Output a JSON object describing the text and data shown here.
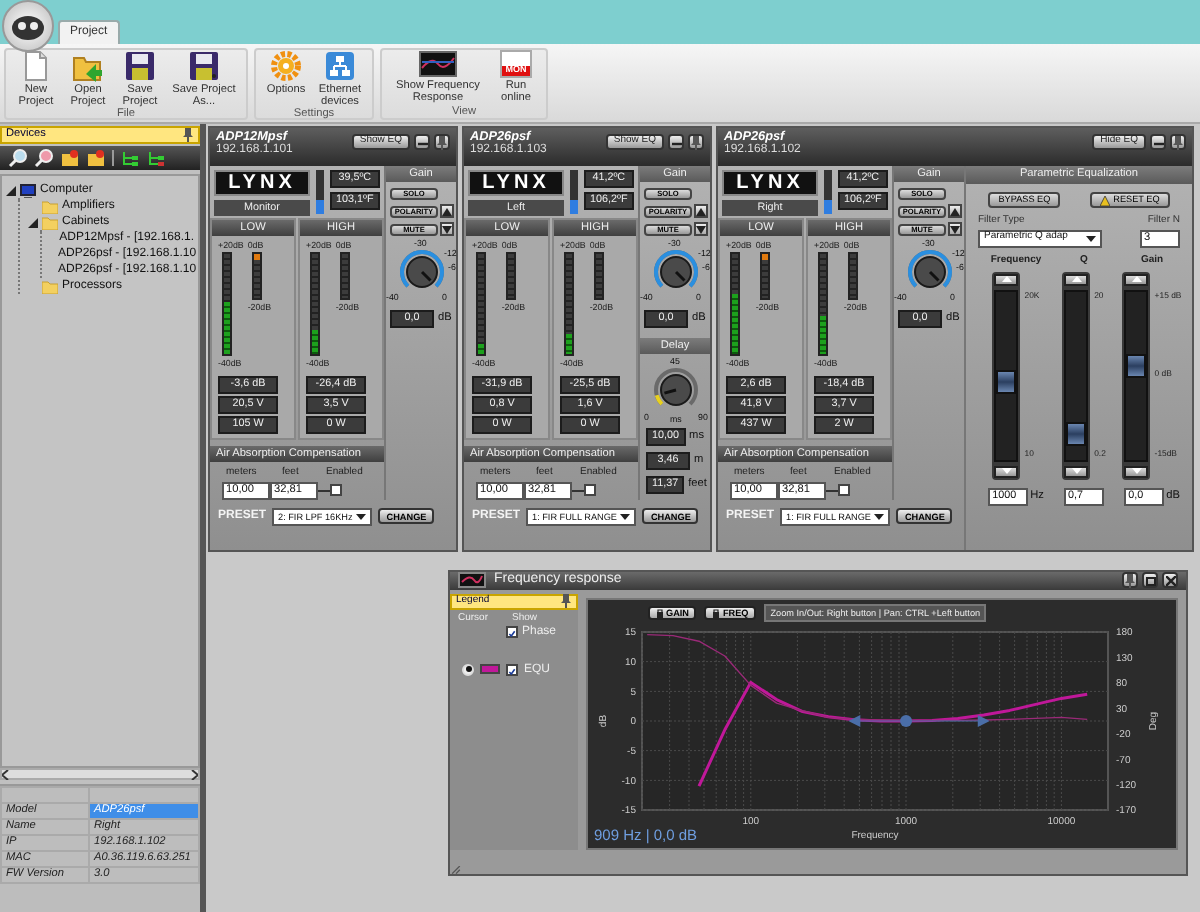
{
  "app_tabs": [
    {
      "label": "Project",
      "selected": true
    }
  ],
  "ribbon": {
    "groups": [
      {
        "label": "File",
        "buttons": [
          {
            "label": "New Project",
            "kind": "new"
          },
          {
            "label": "Open Project",
            "kind": "open"
          },
          {
            "label": "Save Project",
            "kind": "save"
          },
          {
            "label": "Save Project As...",
            "kind": "save-as"
          }
        ]
      },
      {
        "label": "Settings",
        "buttons": [
          {
            "label": "Options",
            "kind": "options"
          },
          {
            "label": "Ethernet devices",
            "kind": "ethernet"
          }
        ]
      },
      {
        "label": "View",
        "buttons": [
          {
            "label": "Show Frequency Response",
            "kind": "frequency"
          },
          {
            "label": "Run online",
            "kind": "online",
            "icon_text": "MON"
          }
        ]
      }
    ]
  },
  "devices_panel": {
    "title": "Devices",
    "tree": [
      {
        "label": "Computer",
        "kind": "computer",
        "expanded": true,
        "children": [
          {
            "label": "Amplifiers",
            "kind": "folder"
          },
          {
            "label": "Cabinets",
            "kind": "folder",
            "expanded": true,
            "children": [
              {
                "label": "ADP12Mpsf - [192.168.1.",
                "kind": "device"
              },
              {
                "label": "ADP26psf - [192.168.1.10",
                "kind": "device"
              },
              {
                "label": "ADP26psf - [192.168.1.10",
                "kind": "device"
              }
            ]
          },
          {
            "label": "Processors",
            "kind": "folder"
          }
        ]
      }
    ],
    "properties": [
      {
        "label": "Model",
        "value": "ADP26psf",
        "selected": true
      },
      {
        "label": "Name",
        "value": "Right",
        "selected": false
      },
      {
        "label": "IP",
        "value": "192.168.1.102",
        "selected": false
      },
      {
        "label": "MAC",
        "value": "A0.36.119.6.63.251",
        "selected": false
      },
      {
        "label": "FW Version",
        "value": "3.0",
        "selected": false
      }
    ]
  },
  "devices": [
    {
      "model": "ADP12Mpsf",
      "ip": "192.168.1.101",
      "eq_button": "Show EQ",
      "logo": "LYNX",
      "name": "Monitor",
      "temperature": {
        "level": 0.3,
        "celsius": "39,5ºC",
        "fahrenheit": "103,1ºF"
      },
      "bands": [
        {
          "title": "LOW",
          "scale_top": [
            "+20dB",
            "0dB"
          ],
          "limiter_label": "-20dB",
          "scale_bottom": "-40dB",
          "level": 0.52,
          "limiter": {
            "level": 0.12
          },
          "readings": [
            "-3,6 dB",
            "20,5 V",
            "105 W"
          ]
        },
        {
          "title": "HIGH",
          "scale_top": [
            "+20dB",
            "0dB"
          ],
          "limiter_label": "-20dB",
          "scale_bottom": "-40dB",
          "level": 0.25,
          "readings": [
            "-26,4 dB",
            "3,5 V",
            "0 W"
          ]
        }
      ],
      "gain": {
        "title": "Gain",
        "buttons": [
          "SOLO",
          "POLARITY",
          "MUTE"
        ],
        "scale": [
          "-30",
          "-12",
          "-6",
          "0",
          "-40"
        ],
        "level": 1,
        "value": "0,0",
        "unit": "dB"
      },
      "air": {
        "title": "Air Absorption Compensation",
        "labels": [
          "meters",
          "feet",
          "Enabled"
        ],
        "meters": "10,00",
        "feet": "32,81",
        "enabled": false
      },
      "preset": {
        "label": "PRESET",
        "value": "2: FIR LPF 16KHz",
        "button": "CHANGE"
      }
    },
    {
      "model": "ADP26psf",
      "ip": "192.168.1.103",
      "eq_button": "Show EQ",
      "logo": "LYNX",
      "name": "Left",
      "temperature": {
        "level": 0.3,
        "celsius": "41,2ºC",
        "fahrenheit": "106,2ºF"
      },
      "bands": [
        {
          "title": "LOW",
          "scale_top": [
            "+20dB",
            "0dB"
          ],
          "limiter_label": "-20dB",
          "scale_bottom": "-40dB",
          "level": 0.1,
          "readings": [
            "-31,9 dB",
            "0,8 V",
            "0 W"
          ]
        },
        {
          "title": "HIGH",
          "scale_top": [
            "+20dB",
            "0dB"
          ],
          "limiter_label": "-20dB",
          "scale_bottom": "-40dB",
          "level": 0.2,
          "readings": [
            "-25,5 dB",
            "1,6 V",
            "0 W"
          ]
        }
      ],
      "gain": {
        "title": "Gain",
        "buttons": [
          "SOLO",
          "POLARITY",
          "MUTE"
        ],
        "scale": [
          "-30",
          "-12",
          "-6",
          "0",
          "-40"
        ],
        "level": 1,
        "value": "0,0",
        "unit": "dB"
      },
      "delay": {
        "title": "Delay",
        "scale": [
          "45",
          "0",
          "ms",
          "90"
        ],
        "level": 0.11,
        "readings": [
          {
            "value": "10,00",
            "unit": "ms"
          },
          {
            "value": "3,46",
            "unit": "m"
          },
          {
            "value": "11,37",
            "unit": "feet"
          }
        ]
      },
      "air": {
        "title": "Air Absorption Compensation",
        "labels": [
          "meters",
          "feet",
          "Enabled"
        ],
        "meters": "10,00",
        "feet": "32,81",
        "enabled": false
      },
      "preset": {
        "label": "PRESET",
        "value": "1: FIR FULL RANGE",
        "button": "CHANGE"
      }
    },
    {
      "model": "ADP26psf",
      "ip": "192.168.1.102",
      "eq_button": "Hide EQ",
      "logo": "LYNX",
      "name": "Right",
      "temperature": {
        "level": 0.3,
        "celsius": "41,2ºC",
        "fahrenheit": "106,2ºF"
      },
      "bands": [
        {
          "title": "LOW",
          "scale_top": [
            "+20dB",
            "0dB"
          ],
          "limiter_label": "-20dB",
          "scale_bottom": "-40dB",
          "level": 0.6,
          "limiter": {
            "level": 0.12
          },
          "readings": [
            "2,6 dB",
            "41,8 V",
            "437 W"
          ]
        },
        {
          "title": "HIGH",
          "scale_top": [
            "+20dB",
            "0dB"
          ],
          "limiter_label": "-20dB",
          "scale_bottom": "-40dB",
          "level": 0.38,
          "readings": [
            "-18,4 dB",
            "3,7 V",
            "2 W"
          ]
        }
      ],
      "gain": {
        "title": "Gain",
        "buttons": [
          "SOLO",
          "POLARITY",
          "MUTE"
        ],
        "scale": [
          "-30",
          "-12",
          "-6",
          "0",
          "-40"
        ],
        "level": 1,
        "value": "0,0",
        "unit": "dB"
      },
      "air": {
        "title": "Air Absorption Compensation",
        "labels": [
          "meters",
          "feet",
          "Enabled"
        ],
        "meters": "10,00",
        "feet": "32,81",
        "enabled": false
      },
      "preset": {
        "label": "PRESET",
        "value": "1: FIR FULL RANGE",
        "button": "CHANGE"
      },
      "eq": {
        "title": "Parametric Equalization",
        "buttons": [
          "BYPASS EQ",
          "RESET EQ"
        ],
        "filter_type_label": "Filter Type",
        "filter_type": "Parametric Q adap",
        "filter_n_label": "Filter N",
        "filter_n": "3",
        "sliders": [
          {
            "label": "Frequency",
            "scale": [
              "20K",
              "10"
            ],
            "level": 0.45,
            "value": "1000",
            "unit": "Hz"
          },
          {
            "label": "Q",
            "scale": [
              "20",
              "0.2"
            ],
            "level": 0.1,
            "value": "0,7"
          },
          {
            "label": "Gain",
            "scale": [
              "+15 dB",
              "0 dB",
              "-15dB"
            ],
            "level": 0.56,
            "value": "0,0",
            "unit": "dB"
          }
        ]
      }
    }
  ],
  "frequency_window": {
    "title": "Frequency response",
    "legend": {
      "title": "Legend",
      "cursor_label": "Cursor",
      "show_label": "Show",
      "phase": {
        "checked": true
      },
      "items": [
        {
          "color": "#c0189a",
          "selected": true,
          "checked": true
        }
      ]
    },
    "buttons": [
      "GAIN",
      "FREQ"
    ],
    "hint": "Zoom In/Out: Right button | Pan: CTRL +Left button",
    "readout": "909 Hz | 0,0 dB",
    "chart_data": {
      "type": "line",
      "xlabel": "Frequency",
      "ylabel": "dB",
      "y2label": "Deg",
      "categories": [
        null,
        null,
        null,
        null,
        "100",
        null,
        null,
        null,
        null,
        null,
        "1000",
        null,
        null,
        null,
        null,
        null,
        "10000",
        null
      ],
      "series": [
        {
          "name": "EQU",
          "color": "#c0189a",
          "values": [
            null,
            null,
            -11,
            -1.5,
            6.5,
            3.6,
            1.6,
            0.7,
            0.2,
            0,
            0,
            0.1,
            0.4,
            1,
            1.8,
            2.8,
            3.8,
            4.5
          ]
        },
        {
          "name": "Phase",
          "color": "#9a2a78",
          "axis": "y2",
          "values": [
            175,
            173,
            162,
            133,
            75,
            40,
            25,
            12,
            8,
            7,
            6,
            6,
            6,
            7,
            8,
            10,
            12,
            8
          ]
        },
        {
          "color": "#4a6ea8",
          "marker": "triangle",
          "values": [
            null,
            null,
            null,
            null,
            null,
            null,
            null,
            null,
            0,
            null,
            0,
            null,
            null,
            0,
            null,
            null,
            null,
            null
          ]
        }
      ],
      "ylim": [
        -15,
        15
      ],
      "y2lim": [
        -170,
        180
      ],
      "grid": true,
      "yticks": [
        -15,
        -10,
        -5,
        0,
        5,
        10,
        15
      ],
      "y2ticks": [
        -170,
        -120,
        -70,
        -20,
        30,
        80,
        130,
        180
      ]
    }
  }
}
